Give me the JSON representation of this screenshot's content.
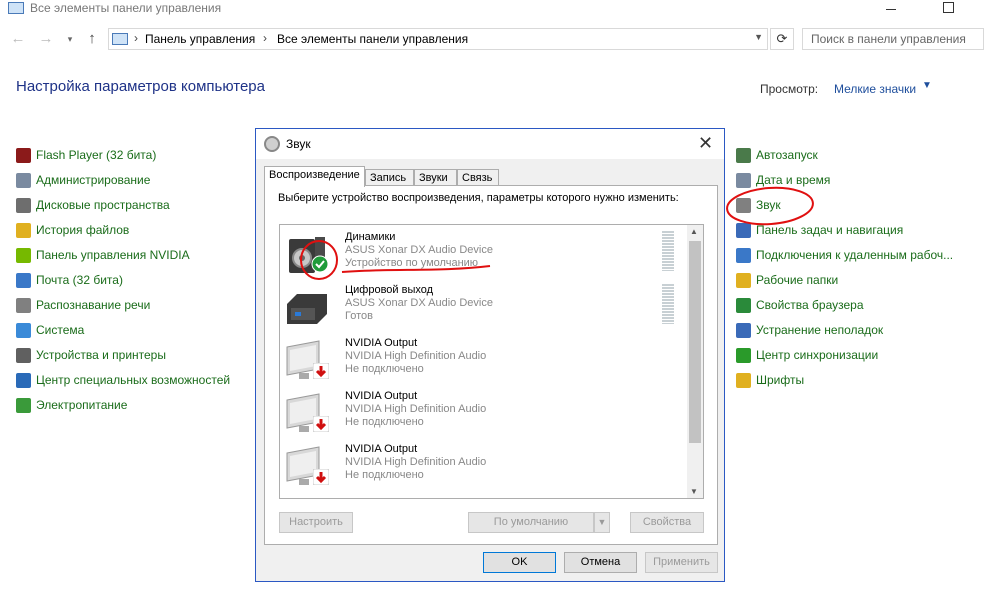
{
  "window": {
    "title": "Все элементы панели управления",
    "back_icon": "back-arrow-icon",
    "forward_icon": "forward-arrow-icon"
  },
  "address": {
    "crumbs": [
      "Панель управления",
      "Все элементы панели управления"
    ],
    "search_placeholder": "Поиск в панели управления"
  },
  "header": {
    "title": "Настройка параметров компьютера",
    "view_label": "Просмотр:",
    "view_value": "Мелкие значки"
  },
  "left_items": [
    {
      "label": "Flash Player (32 бита)",
      "icon": "flash-icon",
      "color": "#8b1a1a"
    },
    {
      "label": "Администрирование",
      "icon": "admin-tools-icon",
      "color": "#7a8aa0"
    },
    {
      "label": "Дисковые пространства",
      "icon": "storage-icon",
      "color": "#6e6e6e"
    },
    {
      "label": "История файлов",
      "icon": "file-history-icon",
      "color": "#e0b020"
    },
    {
      "label": "Панель управления NVIDIA",
      "icon": "nvidia-icon",
      "color": "#76b900"
    },
    {
      "label": "Почта (32 бита)",
      "icon": "mail-icon",
      "color": "#3a78c8"
    },
    {
      "label": "Распознавание речи",
      "icon": "microphone-icon",
      "color": "#808080"
    },
    {
      "label": "Система",
      "icon": "system-icon",
      "color": "#3a8ad8"
    },
    {
      "label": "Устройства и принтеры",
      "icon": "printer-icon",
      "color": "#606060"
    },
    {
      "label": "Центр специальных возможностей",
      "icon": "accessibility-icon",
      "color": "#2a6ab8"
    },
    {
      "label": "Электропитание",
      "icon": "power-icon",
      "color": "#3a9a3a"
    }
  ],
  "right_items": [
    {
      "label": "Автозапуск",
      "icon": "autoplay-icon",
      "color": "#4a7a4a"
    },
    {
      "label": "Дата и время",
      "icon": "clock-icon",
      "color": "#7a8aa0"
    },
    {
      "label": "Звук",
      "icon": "speaker-icon",
      "color": "#808080"
    },
    {
      "label": "Панель задач и навигация",
      "icon": "taskbar-icon",
      "color": "#3a6ab8"
    },
    {
      "label": "Подключения к удаленным рабоч...",
      "icon": "remote-desktop-icon",
      "color": "#3a78c8"
    },
    {
      "label": "Рабочие папки",
      "icon": "work-folders-icon",
      "color": "#e0b020"
    },
    {
      "label": "Свойства браузера",
      "icon": "globe-icon",
      "color": "#2a8a3a"
    },
    {
      "label": "Устранение неполадок",
      "icon": "troubleshoot-icon",
      "color": "#3a6ab8"
    },
    {
      "label": "Центр синхронизации",
      "icon": "sync-icon",
      "color": "#2a9a2a"
    },
    {
      "label": "Шрифты",
      "icon": "fonts-icon",
      "color": "#e0b020"
    }
  ],
  "dialog": {
    "title": "Звук",
    "tabs": [
      "Воспроизведение",
      "Запись",
      "Звуки",
      "Связь"
    ],
    "instruction": "Выберите устройство воспроизведения, параметры которого нужно изменить:",
    "devices": [
      {
        "name": "Динамики",
        "desc": "ASUS Xonar DX Audio Device",
        "status": "Устройство по умолчанию",
        "icon": "speakers-device-icon",
        "badge": "default-check-icon"
      },
      {
        "name": "Цифровой выход",
        "desc": "ASUS Xonar DX Audio Device",
        "status": "Готов",
        "icon": "digital-output-icon",
        "badge": ""
      },
      {
        "name": "NVIDIA Output",
        "desc": "NVIDIA High Definition Audio",
        "status": "Не подключено",
        "icon": "monitor-device-icon",
        "badge": "disconnected-arrow-icon"
      },
      {
        "name": "NVIDIA Output",
        "desc": "NVIDIA High Definition Audio",
        "status": "Не подключено",
        "icon": "monitor-device-icon",
        "badge": "disconnected-arrow-icon"
      },
      {
        "name": "NVIDIA Output",
        "desc": "NVIDIA High Definition Audio",
        "status": "Не подключено",
        "icon": "monitor-device-icon",
        "badge": "disconnected-arrow-icon"
      }
    ],
    "buttons": {
      "configure": "Настроить",
      "default": "По умолчанию",
      "properties": "Свойства",
      "ok": "OK",
      "cancel": "Отмена",
      "apply": "Применить"
    }
  },
  "colors": {
    "accent": "#1e3287",
    "link_green": "#1a6c1a",
    "dialog_border": "#2b58c3",
    "annotation_red": "#e01010"
  }
}
